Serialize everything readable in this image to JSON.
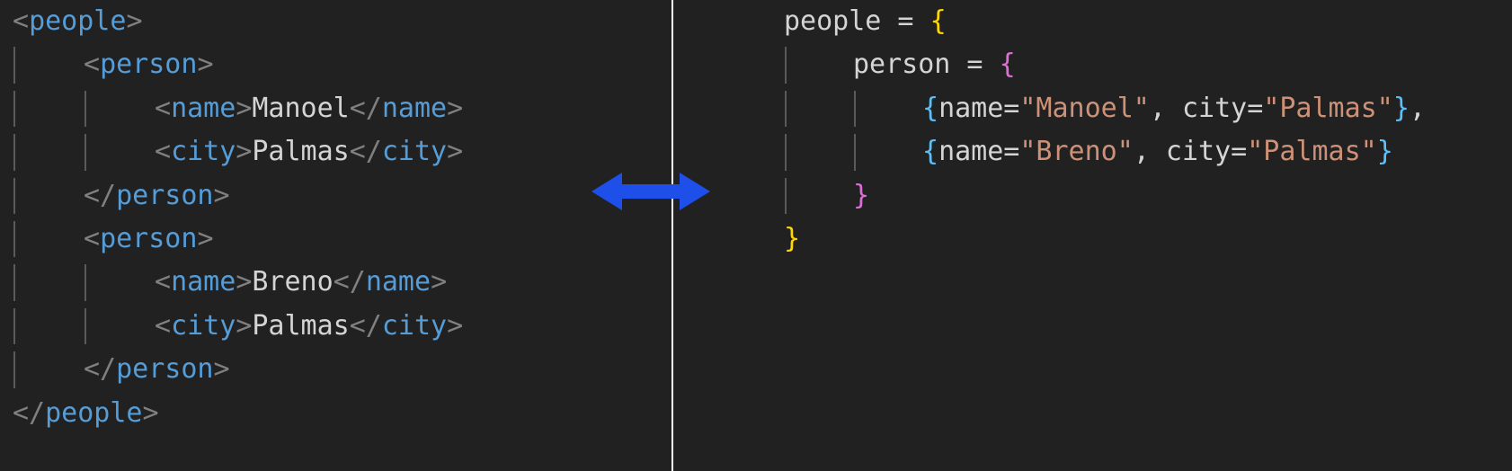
{
  "editor": {
    "background_color": "#212121",
    "divider_color": "#ffffff",
    "arrow_color": "#1e4fe8",
    "colors": {
      "punctuation": "#808080",
      "tag_name": "#569cd6",
      "text_content": "#d4d4d4",
      "string": "#ce9178",
      "bracket_level_1": "#ffd602",
      "bracket_level_2": "#da70d6",
      "bracket_level_3": "#5bc0f8",
      "indent_guide": "#5a5a5a"
    }
  },
  "left_panel": {
    "language": "xml",
    "lines": [
      {
        "indent": 0,
        "tokens": [
          {
            "t": "punct",
            "v": "<"
          },
          {
            "t": "tag",
            "v": "people"
          },
          {
            "t": "punct",
            "v": ">"
          }
        ]
      },
      {
        "indent": 1,
        "tokens": [
          {
            "t": "punct",
            "v": "<"
          },
          {
            "t": "tag",
            "v": "person"
          },
          {
            "t": "punct",
            "v": ">"
          }
        ]
      },
      {
        "indent": 2,
        "tokens": [
          {
            "t": "punct",
            "v": "<"
          },
          {
            "t": "tag",
            "v": "name"
          },
          {
            "t": "punct",
            "v": ">"
          },
          {
            "t": "text",
            "v": "Manoel"
          },
          {
            "t": "punct",
            "v": "</"
          },
          {
            "t": "tag",
            "v": "name"
          },
          {
            "t": "punct",
            "v": ">"
          }
        ]
      },
      {
        "indent": 2,
        "tokens": [
          {
            "t": "punct",
            "v": "<"
          },
          {
            "t": "tag",
            "v": "city"
          },
          {
            "t": "punct",
            "v": ">"
          },
          {
            "t": "text",
            "v": "Palmas"
          },
          {
            "t": "punct",
            "v": "</"
          },
          {
            "t": "tag",
            "v": "city"
          },
          {
            "t": "punct",
            "v": ">"
          }
        ]
      },
      {
        "indent": 1,
        "tokens": [
          {
            "t": "punct",
            "v": "</"
          },
          {
            "t": "tag",
            "v": "person"
          },
          {
            "t": "punct",
            "v": ">"
          }
        ]
      },
      {
        "indent": 1,
        "tokens": [
          {
            "t": "punct",
            "v": "<"
          },
          {
            "t": "tag",
            "v": "person"
          },
          {
            "t": "punct",
            "v": ">"
          }
        ]
      },
      {
        "indent": 2,
        "tokens": [
          {
            "t": "punct",
            "v": "<"
          },
          {
            "t": "tag",
            "v": "name"
          },
          {
            "t": "punct",
            "v": ">"
          },
          {
            "t": "text",
            "v": "Breno"
          },
          {
            "t": "punct",
            "v": "</"
          },
          {
            "t": "tag",
            "v": "name"
          },
          {
            "t": "punct",
            "v": ">"
          }
        ]
      },
      {
        "indent": 2,
        "tokens": [
          {
            "t": "punct",
            "v": "<"
          },
          {
            "t": "tag",
            "v": "city"
          },
          {
            "t": "punct",
            "v": ">"
          },
          {
            "t": "text",
            "v": "Palmas"
          },
          {
            "t": "punct",
            "v": "</"
          },
          {
            "t": "tag",
            "v": "city"
          },
          {
            "t": "punct",
            "v": ">"
          }
        ]
      },
      {
        "indent": 1,
        "tokens": [
          {
            "t": "punct",
            "v": "</"
          },
          {
            "t": "tag",
            "v": "person"
          },
          {
            "t": "punct",
            "v": ">"
          }
        ]
      },
      {
        "indent": 0,
        "tokens": [
          {
            "t": "punct",
            "v": "</"
          },
          {
            "t": "tag",
            "v": "people"
          },
          {
            "t": "punct",
            "v": ">"
          }
        ]
      }
    ],
    "plain_text": "<people>\n    <person>\n        <name>Manoel</name>\n        <city>Palmas</city>\n    </person>\n    <person>\n        <name>Breno</name>\n        <city>Palmas</city>\n    </person>\n</people>"
  },
  "right_panel": {
    "language": "object-literal",
    "lines": [
      {
        "indent": 0,
        "tokens": [
          {
            "t": "plain",
            "v": "people = "
          },
          {
            "t": "br1",
            "v": "{"
          }
        ]
      },
      {
        "indent": 1,
        "tokens": [
          {
            "t": "plain",
            "v": "person = "
          },
          {
            "t": "br2",
            "v": "{"
          }
        ]
      },
      {
        "indent": 2,
        "tokens": [
          {
            "t": "br3",
            "v": "{"
          },
          {
            "t": "plain",
            "v": "name="
          },
          {
            "t": "str",
            "v": "\"Manoel\""
          },
          {
            "t": "plain",
            "v": ", city="
          },
          {
            "t": "str",
            "v": "\"Palmas\""
          },
          {
            "t": "br3",
            "v": "}"
          },
          {
            "t": "plain",
            "v": ","
          }
        ]
      },
      {
        "indent": 2,
        "tokens": [
          {
            "t": "br3",
            "v": "{"
          },
          {
            "t": "plain",
            "v": "name="
          },
          {
            "t": "str",
            "v": "\"Breno\""
          },
          {
            "t": "plain",
            "v": ", city="
          },
          {
            "t": "str",
            "v": "\"Palmas\""
          },
          {
            "t": "br3",
            "v": "}"
          }
        ]
      },
      {
        "indent": 1,
        "tokens": [
          {
            "t": "br2",
            "v": "}"
          }
        ]
      },
      {
        "indent": 0,
        "tokens": [
          {
            "t": "br1",
            "v": "}"
          }
        ]
      }
    ],
    "plain_text": "people = {\n    person = {\n        {name=\"Manoel\", city=\"Palmas\"},\n        {name=\"Breno\", city=\"Palmas\"}\n    }\n}"
  },
  "arrow": {
    "label": "bidirectional-conversion",
    "direction": "both"
  }
}
